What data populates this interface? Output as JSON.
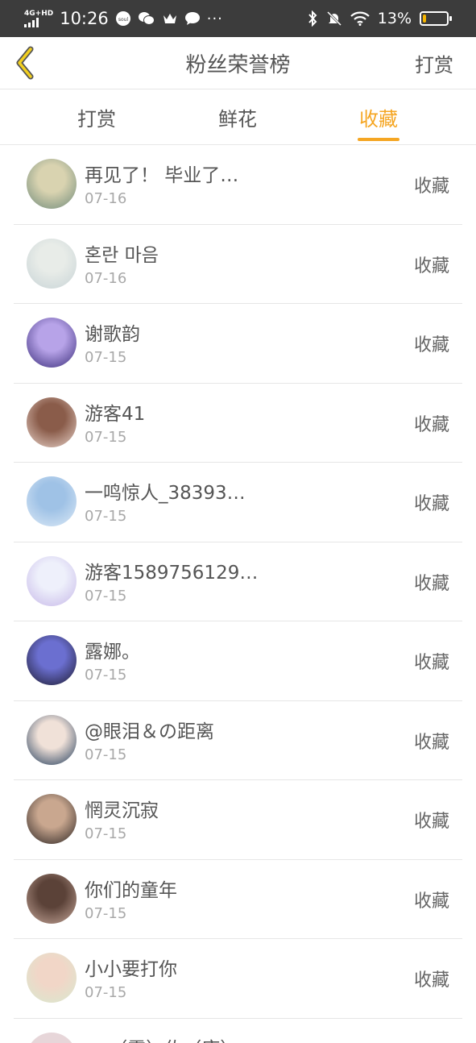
{
  "status_bar": {
    "network": "4G+HD",
    "time": "10:26",
    "battery_pct": "13%",
    "battery_level": 0.13,
    "more": "···",
    "icons": [
      "signal-icon",
      "soul-app-icon",
      "wechat-icon",
      "crown-icon",
      "chat-bubble-icon",
      "bluetooth-icon",
      "mute-bell-icon",
      "wifi-icon",
      "battery-icon"
    ]
  },
  "nav": {
    "title": "粉丝荣誉榜",
    "action": "打赏",
    "back_icon": "chevron-left-icon"
  },
  "tabs": [
    {
      "label": "打赏",
      "active": false
    },
    {
      "label": "鲜花",
      "active": false
    },
    {
      "label": "收藏",
      "active": true
    }
  ],
  "colors": {
    "accent": "#f5a623",
    "status_bar_bg": "#3c3c3c"
  },
  "fans": [
    {
      "name": "再见了！ 毕业了…",
      "date": "07-16",
      "action": "收藏",
      "avatar_colors": [
        "#6f8a7a",
        "#d9d3b0"
      ]
    },
    {
      "name": "혼란 마음",
      "date": "07-16",
      "action": "收藏",
      "avatar_colors": [
        "#c7d3d6",
        "#e8ece8"
      ]
    },
    {
      "name": "谢歌韵",
      "date": "07-15",
      "action": "收藏",
      "avatar_colors": [
        "#3a2d7a",
        "#b7a3e8"
      ]
    },
    {
      "name": "游客41",
      "date": "07-15",
      "action": "收藏",
      "avatar_colors": [
        "#e8d2c9",
        "#8a5c4a"
      ]
    },
    {
      "name": "一鸣惊人_38393…",
      "date": "07-15",
      "action": "收藏",
      "avatar_colors": [
        "#dce9f6",
        "#9fc2e6"
      ]
    },
    {
      "name": "游客1589756129…",
      "date": "07-15",
      "action": "收藏",
      "avatar_colors": [
        "#c6b7e8",
        "#eef0fb"
      ]
    },
    {
      "name": "露娜。",
      "date": "07-15",
      "action": "收藏",
      "avatar_colors": [
        "#1c1a2e",
        "#6b6fd0"
      ]
    },
    {
      "name": "@眼泪＆の距离",
      "date": "07-15",
      "action": "收藏",
      "avatar_colors": [
        "#1f3a5a",
        "#f0e1d8"
      ]
    },
    {
      "name": "惘灵沉寂",
      "date": "07-15",
      "action": "收藏",
      "avatar_colors": [
        "#2a2322",
        "#c9a78f"
      ]
    },
    {
      "name": "你们的童年",
      "date": "07-15",
      "action": "收藏",
      "avatar_colors": [
        "#c6a79a",
        "#5b4238"
      ]
    },
    {
      "name": "小小要打你",
      "date": "07-15",
      "action": "收藏",
      "avatar_colors": [
        "#d8e9cf",
        "#f1d6c7"
      ]
    }
  ],
  "partial_fan": {
    "name": "… （零）佐（康）…"
  }
}
